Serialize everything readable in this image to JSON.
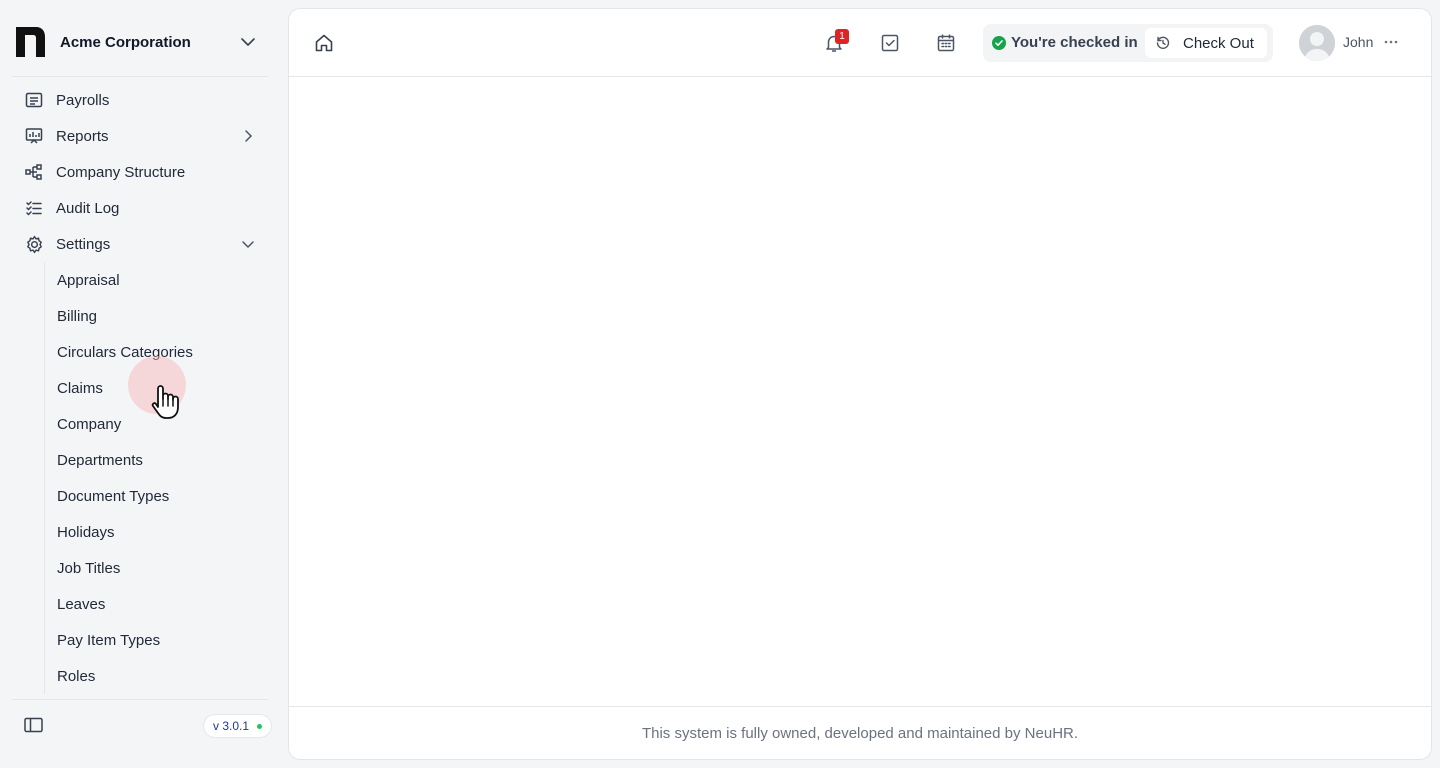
{
  "org": {
    "name": "Acme Corporation"
  },
  "nav": {
    "items": [
      {
        "label": "Payrolls",
        "icon": "payroll-icon"
      },
      {
        "label": "Reports",
        "icon": "reports-icon"
      },
      {
        "label": "Company Structure",
        "icon": "structure-icon"
      },
      {
        "label": "Audit Log",
        "icon": "audit-log-icon"
      },
      {
        "label": "Settings",
        "icon": "gear-icon"
      }
    ],
    "settings_children": [
      "Appraisal",
      "Billing",
      "Circulars Categories",
      "Claims",
      "Company",
      "Departments",
      "Document Types",
      "Holidays",
      "Job Titles",
      "Leaves",
      "Pay Item Types",
      "Roles"
    ]
  },
  "sidebar_footer": {
    "version": "v 3.0.1",
    "status_color": "#22c55e"
  },
  "topbar": {
    "notification_count": "1",
    "checkin_status": "You're checked in",
    "checkout_label": "Check Out",
    "user_name": "John"
  },
  "footer": {
    "text": "This system is fully owned, developed and maintained by NeuHR."
  },
  "colors": {
    "accent_danger": "#dc2626",
    "status_success": "#16a34a"
  }
}
